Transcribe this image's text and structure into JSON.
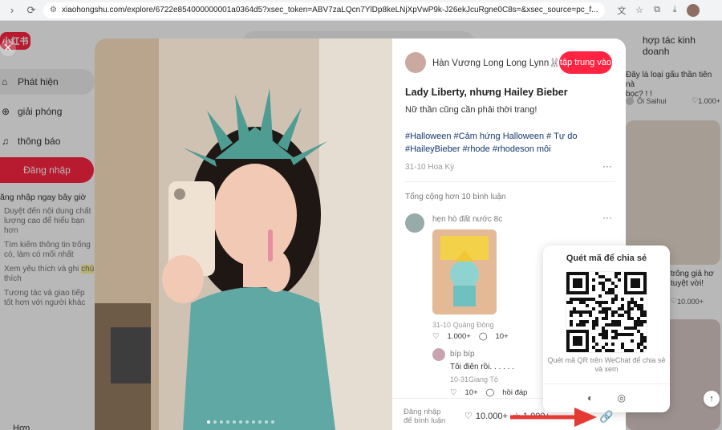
{
  "browser": {
    "url": "xiaohongshu.com/explore/6722e854000000001a0364d5?xsec_token=ABV7zaLQcn7YlDp8keLNjXpVwP9k-J26ekJcuRgne0C8s=&xsec_source=pc_f..."
  },
  "sidebar": {
    "logo": "小红书",
    "items": [
      {
        "label": "Phát hiện",
        "icon": "home-icon"
      },
      {
        "label": "giải phóng",
        "icon": "plus-circle-icon"
      },
      {
        "label": "thông báo",
        "icon": "bell-icon"
      }
    ],
    "login_label": "Đăng nhập",
    "login_panel_title": "ăng nhập ngay bây giờ",
    "login_points": [
      "Duyệt đến nội dung chất lượng cao để hiểu bạn hơn",
      "Tìm kiếm thông tin trống có, làm có mối nhất",
      "Xem yêu thích và ghi",
      "thích",
      "Tương tác và giao tiếp tốt hơn với người khác"
    ],
    "highlight_word": "chú",
    "more_label": "Hơn"
  },
  "header": {
    "right_link": "hợp tác kinh doanh"
  },
  "feed": {
    "card1_title": "Đây là loại gấu thần tiên nà\nbọc? ! !",
    "card1_author": "Ôi Saihui",
    "card1_likes": "1.000+",
    "card2_title": "trông giả hơ\ntuyệt vời!",
    "card2_likes": "10.000+"
  },
  "post": {
    "author": "Hàn Vương Long Long Lynn🐰",
    "follow_label": "tập trung vào",
    "title": "Lady Liberty, nhưng Hailey Bieber",
    "desc": "Nữ thần cũng cần phải thời trang!",
    "tags": "#Halloween #Cảm hứng Halloween # Tự do #HaileyBieber #rhode #rhodeson môi",
    "date": "31-10 Hoa Kỳ",
    "comment_count": "Tổng cộng hơn 10 bình luận",
    "comments": [
      {
        "name": "hẹn hò đất nước 8c",
        "meta": "31-10  Quảng Đông",
        "likes": "1.000+",
        "replies": "10+"
      },
      {
        "name": "bíp bíp",
        "text": "Tôi điên rồi. . . . . .",
        "meta": "10-31Giang Tô",
        "likes": "10+",
        "reply_label": "hồi đáp"
      }
    ],
    "login_comment": "Đăng nhập\nđể bình luận",
    "like_count": "10.000+",
    "star_count": "1.000+"
  },
  "share": {
    "title": "Quét mã để chia sẻ",
    "hint": "Quét mã QR trên WeChat để chia sẻ và xem"
  },
  "colors": {
    "brand": "#ff2442",
    "tag": "#13386c",
    "arrow": "#e53935"
  }
}
